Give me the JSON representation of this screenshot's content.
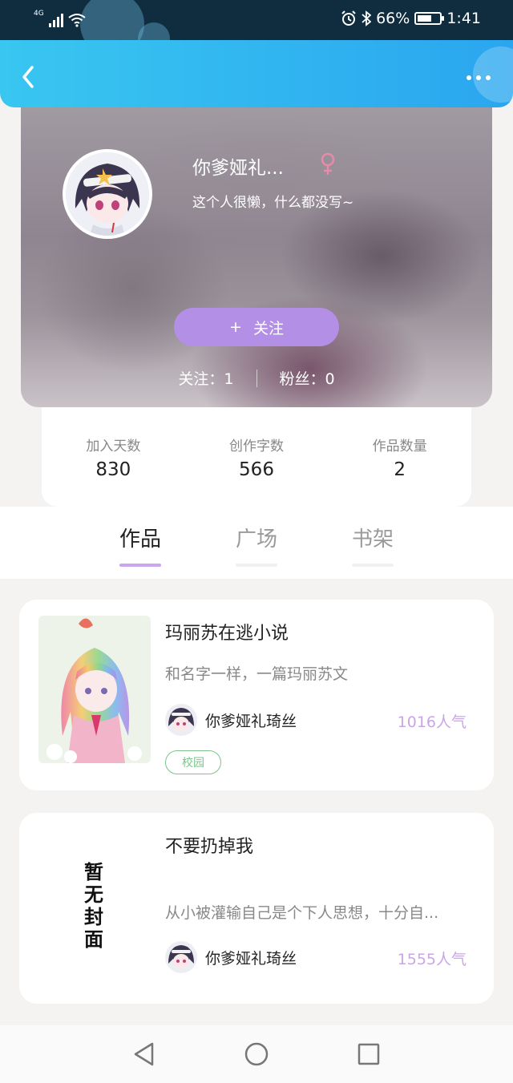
{
  "status_bar": {
    "network": "4G",
    "battery": "66%",
    "battery_level": 0.66,
    "time": "1:41"
  },
  "header": {
    "back_icon": "chevron-left-icon",
    "more_icon": "more-horizontal-icon"
  },
  "profile": {
    "nickname": "你爹娅礼...",
    "gender_symbol": "♀",
    "gender_color": "#e98aa8",
    "bio": "这个人很懒，什么都没写~",
    "follow_button": {
      "plus": "+",
      "label": "关注"
    },
    "following": "关注：1",
    "fans": "粉丝：0"
  },
  "stats": [
    {
      "label": "加入天数",
      "value": "830"
    },
    {
      "label": "创作字数",
      "value": "566"
    },
    {
      "label": "作品数量",
      "value": "2"
    }
  ],
  "tabs": [
    {
      "label": "作品",
      "active": true
    },
    {
      "label": "广场",
      "active": false
    },
    {
      "label": "书架",
      "active": false
    }
  ],
  "works": [
    {
      "title": "玛丽苏在逃小说",
      "description": "和名字一样，一篇玛丽苏文",
      "author": "你爹娅礼琦丝",
      "popularity": "1016人气",
      "tag": "校园",
      "has_cover": true
    },
    {
      "title": "不要扔掉我",
      "description": "从小被灌输自己是个下人思想，十分自...",
      "author": "你爹娅礼琦丝",
      "popularity": "1555人气",
      "cover_placeholder": "暂无封面",
      "has_cover": false
    }
  ],
  "nav": {
    "back_icon": "triangle-back-icon",
    "home_icon": "circle-home-icon",
    "recents_icon": "square-recents-icon"
  },
  "colors": {
    "header_blue": "#2aa6ef",
    "accent_purple": "#b48fe6",
    "tag_green": "#7cc48a"
  }
}
